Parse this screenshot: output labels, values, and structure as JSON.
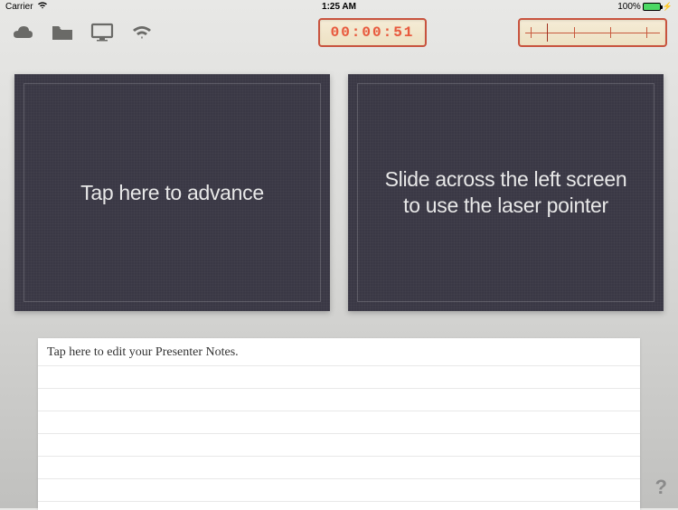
{
  "statusBar": {
    "carrier": "Carrier",
    "time": "1:25 AM",
    "battery": "100%"
  },
  "timer": {
    "display": "00:00:51"
  },
  "slides": {
    "left_text": "Tap here to advance",
    "right_text": "Slide across the left screen to use the laser pointer"
  },
  "notes": {
    "placeholder": "Tap here to edit your Presenter Notes."
  },
  "help": {
    "label": "?"
  }
}
